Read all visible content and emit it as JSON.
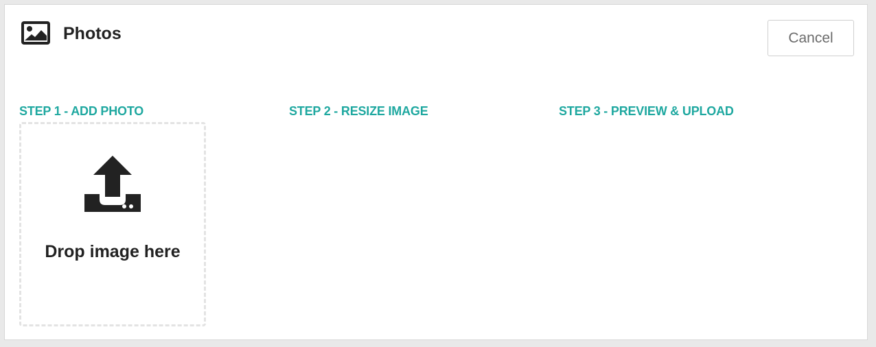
{
  "dialog": {
    "title": "Photos",
    "title_icon": "image-icon",
    "cancel_label": "Cancel"
  },
  "steps": [
    {
      "label": "STEP 1 - ADD PHOTO"
    },
    {
      "label": "STEP 2 - RESIZE IMAGE"
    },
    {
      "label": "STEP 3 - PREVIEW & UPLOAD"
    }
  ],
  "dropzone": {
    "icon": "upload-icon",
    "text": "Drop image here"
  },
  "colors": {
    "accent": "#1fa8a0",
    "text": "#222222",
    "border": "#d7d7d7"
  }
}
